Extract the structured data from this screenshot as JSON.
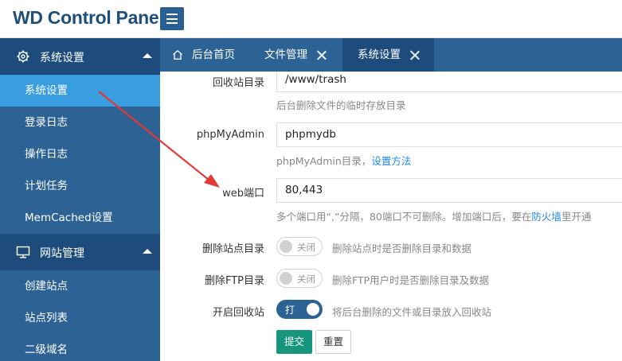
{
  "header": {
    "logo": "WD Control Panel"
  },
  "sidebar": {
    "groups": [
      {
        "label": "系统设置",
        "icon": "gear-icon"
      },
      {
        "label": "网站管理",
        "icon": "monitor-icon"
      }
    ],
    "items_system": [
      "系统设置",
      "登录日志",
      "操作日志",
      "计划任务",
      "MemCached设置"
    ],
    "items_site": [
      "创建站点",
      "站点列表",
      "二级域名"
    ]
  },
  "tabs": [
    {
      "label": "后台首页",
      "icon": "home-icon"
    },
    {
      "label": "文件管理"
    },
    {
      "label": "系统设置"
    }
  ],
  "form": {
    "trash_dir": {
      "label": "回收站目录",
      "value": "/www/trash",
      "hint": "后台删除文件的临时存放目录"
    },
    "phpmyadmin": {
      "label": "phpMyAdmin",
      "value": "phpmydb",
      "hint": "phpMyAdmin目录，",
      "hint_link": "设置方法"
    },
    "web_port": {
      "label": "web端口",
      "value": "80,443",
      "hint": "多个端口用“,”分隔，80端口不可删除。增加端口后，要在",
      "hint_link": "防火墙",
      "hint_tail": "里开通"
    },
    "del_site_dir": {
      "label": "删除站点目录",
      "toggle": "关闭",
      "state": "off",
      "hint": "删除站点时是否删除目录和数据"
    },
    "del_ftp_dir": {
      "label": "删除FTP目录",
      "toggle": "关闭",
      "state": "off",
      "hint": "删除FTP用户时是否删除目录及数据"
    },
    "recycle": {
      "label": "开启回收站",
      "toggle": "打",
      "state": "on",
      "hint": "将后台删除的文件或目录放入回收站"
    },
    "submit": "提交",
    "reset": "重置"
  },
  "colors": {
    "sidebar": "#2d6294",
    "sidebar_dark": "#1d4c7c",
    "active": "#3a9de0",
    "submit": "#16967c",
    "arrow": "#e53935"
  }
}
